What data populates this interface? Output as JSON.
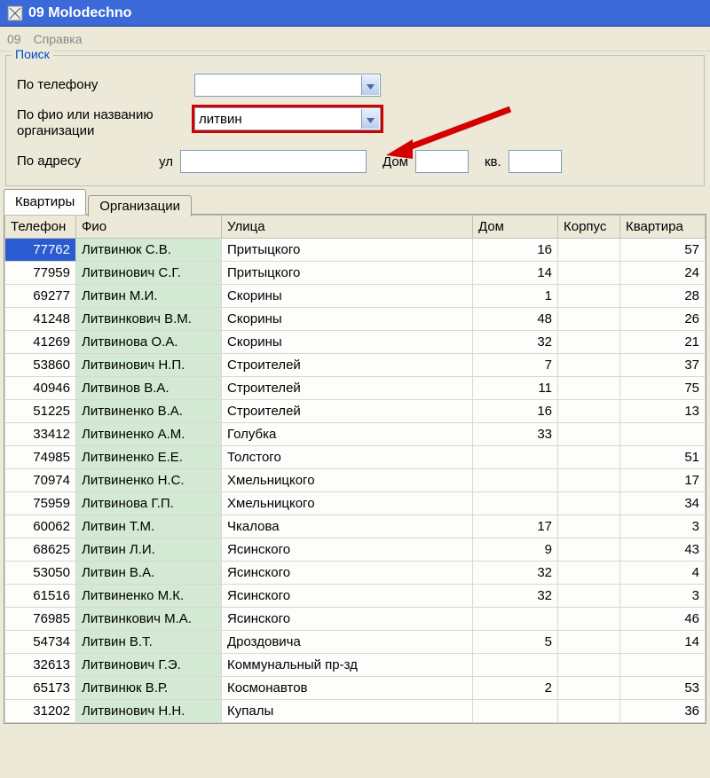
{
  "window": {
    "title": "09 Molodechno"
  },
  "menu": {
    "m0": "09",
    "m1": "Справка"
  },
  "search": {
    "legend": "Поиск",
    "by_phone_label": "По телефону",
    "by_phone_value": "",
    "by_name_label": "По фио или названию организации",
    "by_name_value": "литвин",
    "by_addr_label": "По адресу",
    "street_prefix": "ул",
    "street_value": "",
    "house_label": "Дом",
    "house_value": "",
    "flat_label": "кв.",
    "flat_value": ""
  },
  "tabs": {
    "apartments": "Квартиры",
    "orgs": "Организации"
  },
  "grid": {
    "headers": {
      "phone": "Телефон",
      "fio": "Фио",
      "street": "Улица",
      "house": "Дом",
      "korpus": "Корпус",
      "flat": "Квартира"
    },
    "rows": [
      {
        "phone": "77762",
        "fio": "Литвинюк С.В.",
        "street": "Притыцкого",
        "house": "16",
        "korpus": "",
        "flat": "57",
        "selected": true
      },
      {
        "phone": "77959",
        "fio": "Литвинович С.Г.",
        "street": "Притыцкого",
        "house": "14",
        "korpus": "",
        "flat": "24"
      },
      {
        "phone": "69277",
        "fio": "Литвин М.И.",
        "street": "Скорины",
        "house": "1",
        "korpus": "",
        "flat": "28"
      },
      {
        "phone": "41248",
        "fio": "Литвинкович В.М.",
        "street": "Скорины",
        "house": "48",
        "korpus": "",
        "flat": "26"
      },
      {
        "phone": "41269",
        "fio": "Литвинова О.А.",
        "street": "Скорины",
        "house": "32",
        "korpus": "",
        "flat": "21"
      },
      {
        "phone": "53860",
        "fio": "Литвинович Н.П.",
        "street": "Строителей",
        "house": "7",
        "korpus": "",
        "flat": "37"
      },
      {
        "phone": "40946",
        "fio": "Литвинов В.А.",
        "street": "Строителей",
        "house": "11",
        "korpus": "",
        "flat": "75"
      },
      {
        "phone": "51225",
        "fio": "Литвиненко В.А.",
        "street": "Строителей",
        "house": "16",
        "korpus": "",
        "flat": "13"
      },
      {
        "phone": "33412",
        "fio": "Литвиненко А.М.",
        "street": "Голубка",
        "house": "33",
        "korpus": "",
        "flat": ""
      },
      {
        "phone": "74985",
        "fio": "Литвиненко Е.Е.",
        "street": "Толстого",
        "house": "",
        "korpus": "",
        "flat": "51"
      },
      {
        "phone": "70974",
        "fio": "Литвиненко Н.С.",
        "street": "Хмельницкого",
        "house": "",
        "korpus": "",
        "flat": "17"
      },
      {
        "phone": "75959",
        "fio": "Литвинова Г.П.",
        "street": "Хмельницкого",
        "house": "",
        "korpus": "",
        "flat": "34"
      },
      {
        "phone": "60062",
        "fio": "Литвин Т.М.",
        "street": "Чкалова",
        "house": "17",
        "korpus": "",
        "flat": "3"
      },
      {
        "phone": "68625",
        "fio": "Литвин Л.И.",
        "street": "Ясинского",
        "house": "9",
        "korpus": "",
        "flat": "43"
      },
      {
        "phone": "53050",
        "fio": "Литвин В.А.",
        "street": "Ясинского",
        "house": "32",
        "korpus": "",
        "flat": "4"
      },
      {
        "phone": "61516",
        "fio": "Литвиненко М.К.",
        "street": "Ясинского",
        "house": "32",
        "korpus": "",
        "flat": "3"
      },
      {
        "phone": "76985",
        "fio": "Литвинкович М.А.",
        "street": "Ясинского",
        "house": "",
        "korpus": "",
        "flat": "46"
      },
      {
        "phone": "54734",
        "fio": "Литвин В.Т.",
        "street": "Дроздовича",
        "house": "5",
        "korpus": "",
        "flat": "14"
      },
      {
        "phone": "32613",
        "fio": "Литвинович Г.Э.",
        "street": "Коммунальный пр-зд",
        "house": "",
        "korpus": "",
        "flat": ""
      },
      {
        "phone": "65173",
        "fio": "Литвинюк В.Р.",
        "street": "Космонавтов",
        "house": "2",
        "korpus": "",
        "flat": "53"
      },
      {
        "phone": "31202",
        "fio": "Литвинович Н.Н.",
        "street": "Купалы",
        "house": "",
        "korpus": "",
        "flat": "36"
      }
    ]
  }
}
